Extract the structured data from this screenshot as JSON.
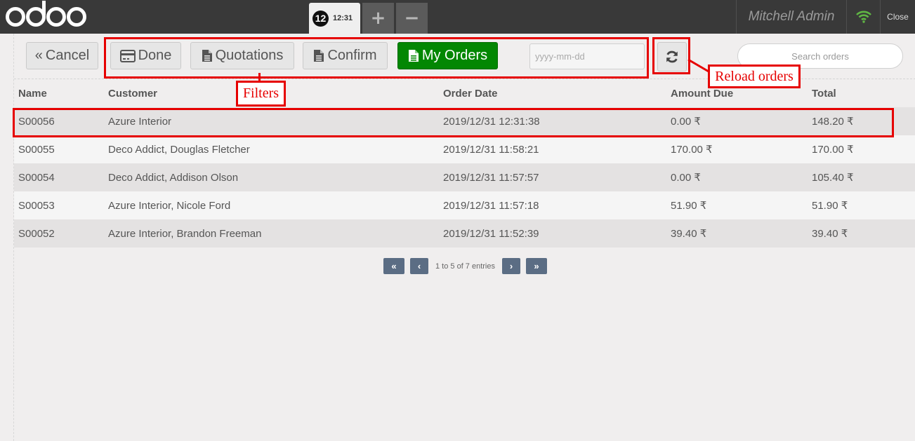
{
  "topbar": {
    "order_number": "12",
    "order_time": "12:31",
    "add_order": "+",
    "remove_order": "−",
    "user_name": "Mitchell Admin",
    "close_label": "Close"
  },
  "toolbar": {
    "cancel_label": "Cancel",
    "filters": [
      {
        "label": "Done",
        "icon": "credit-card-icon",
        "active": false
      },
      {
        "label": "Quotations",
        "icon": "file-icon",
        "active": false
      },
      {
        "label": "Confirm",
        "icon": "file-icon",
        "active": false
      },
      {
        "label": "My Orders",
        "icon": "file-icon",
        "active": true
      }
    ],
    "date_placeholder": "yyyy-mm-dd",
    "search_placeholder": "Search orders"
  },
  "table": {
    "columns": [
      "Name",
      "Customer",
      "Order Date",
      "Amount Due",
      "Total"
    ],
    "rows": [
      [
        "S00056",
        "Azure Interior",
        "2019/12/31 12:31:38",
        "0.00 ₹",
        "148.20 ₹"
      ],
      [
        "S00055",
        "Deco Addict, Douglas Fletcher",
        "2019/12/31 11:58:21",
        "170.00 ₹",
        "170.00 ₹"
      ],
      [
        "S00054",
        "Deco Addict, Addison Olson",
        "2019/12/31 11:57:57",
        "0.00 ₹",
        "105.40 ₹"
      ],
      [
        "S00053",
        "Azure Interior, Nicole Ford",
        "2019/12/31 11:57:18",
        "51.90 ₹",
        "51.90 ₹"
      ],
      [
        "S00052",
        "Azure Interior, Brandon Freeman",
        "2019/12/31 11:52:39",
        "39.40 ₹",
        "39.40 ₹"
      ]
    ]
  },
  "pager": {
    "info": "1 to 5 of 7 entries",
    "first": "«",
    "prev": "‹",
    "next": "›",
    "last": "»"
  },
  "annotations": {
    "filters_label": "Filters",
    "reload_label": "Reload orders"
  },
  "colors": {
    "topbar": "#393939",
    "active_filter": "#038703",
    "annotation": "#e60000",
    "pager_button": "#5b6d84"
  }
}
